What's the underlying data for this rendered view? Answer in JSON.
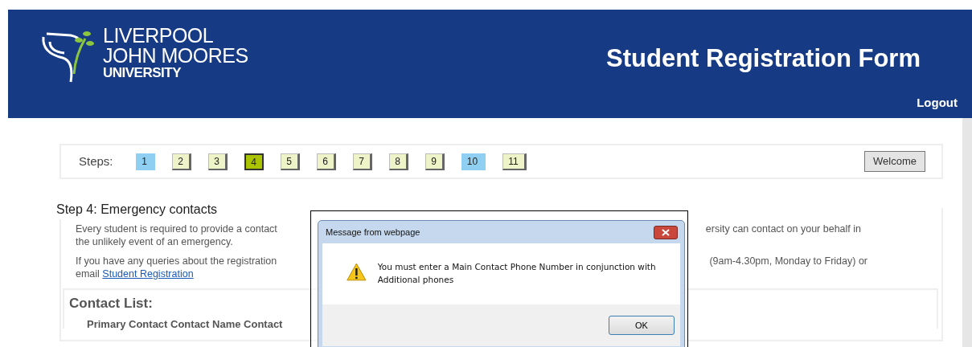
{
  "header": {
    "logo_lines": [
      "LIVERPOOL",
      "JOHN MOORES",
      "UNIVERSITY"
    ],
    "title": "Student Registration Form",
    "logout": "Logout"
  },
  "steps": {
    "label": "Steps:",
    "items": [
      {
        "label": "1",
        "selected": false,
        "completed": true
      },
      {
        "label": "2",
        "selected": false,
        "completed": false
      },
      {
        "label": "3",
        "selected": false,
        "completed": false
      },
      {
        "label": "4",
        "selected": true,
        "completed": false
      },
      {
        "label": "5",
        "selected": false,
        "completed": false
      },
      {
        "label": "6",
        "selected": false,
        "completed": false
      },
      {
        "label": "7",
        "selected": false,
        "completed": false
      },
      {
        "label": "8",
        "selected": false,
        "completed": false
      },
      {
        "label": "9",
        "selected": false,
        "completed": false
      },
      {
        "label": "10",
        "selected": false,
        "completed": true
      },
      {
        "label": "11",
        "selected": false,
        "completed": false
      }
    ],
    "welcome_button": "Welcome"
  },
  "section": {
    "legend": "Step 4: Emergency contacts",
    "paragraph_1": {
      "left_line_1": "Every student is required to provide a contact",
      "right_line_1": "ersity can contact on your behalf in",
      "line_2": "the unlikely event of an emergency."
    },
    "paragraph_2": {
      "left_line_1": "If you have any queries about the registration",
      "right_line_1": "(9am-4.30pm, Monday to Friday) or",
      "line_2_prefix": "email",
      "link": "Student Registration"
    },
    "contact_list": {
      "heading": "Contact List:",
      "columns": "Primary Contact  Contact Name  Contact"
    }
  },
  "dialog": {
    "title": "Message from webpage",
    "message": "You must enter a Main Contact Phone Number in conjunction with Additional phones",
    "ok_button": "OK"
  }
}
